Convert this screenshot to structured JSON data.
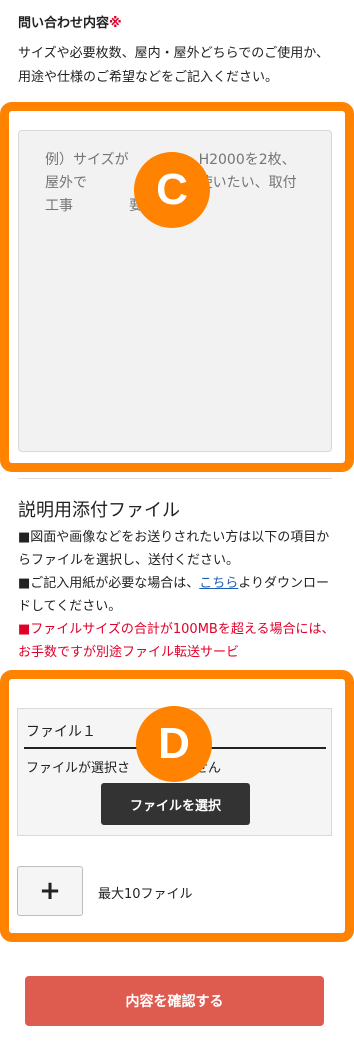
{
  "inquiry": {
    "label": "問い合わせ内容",
    "required_mark": "※",
    "helper_text": "サイズや必要枚数、屋内・屋外どちらでのご使用か、用途や仕様のご希望などをご記入ください。",
    "placeholder": "例）サイズが　　　　　H2000を2枚、屋外で　　　　　として使いたい、取付工事　　　　要など"
  },
  "annotations": {
    "c_label": "C",
    "d_label": "D",
    "color": "#ff8200"
  },
  "attachment": {
    "title": "説明用添付ファイル",
    "line1": "■図面や画像などをお送りされたい方は以下の項目からファイルを選択し、送付ください。",
    "line2_prefix": "■ご記入用紙が必要な場合は、",
    "line2_link": "こちら",
    "line2_suffix": "よりダウンロードしてください。",
    "line3": "■ファイルサイズの合計が100MBを超える場合には、お手数ですが別途ファイル転送サービ",
    "file_label": "ファイル１",
    "file_status": "ファイルが選択さ　　　　　せん",
    "select_button": "ファイルを選択",
    "add_button": "+",
    "max_text": "最大10ファイル"
  },
  "confirm_button": "内容を確認する",
  "colors": {
    "accent_orange": "#ff8200",
    "confirm_red": "#de5b50",
    "required_red": "#e0002a",
    "link_blue": "#1a5fb4"
  }
}
